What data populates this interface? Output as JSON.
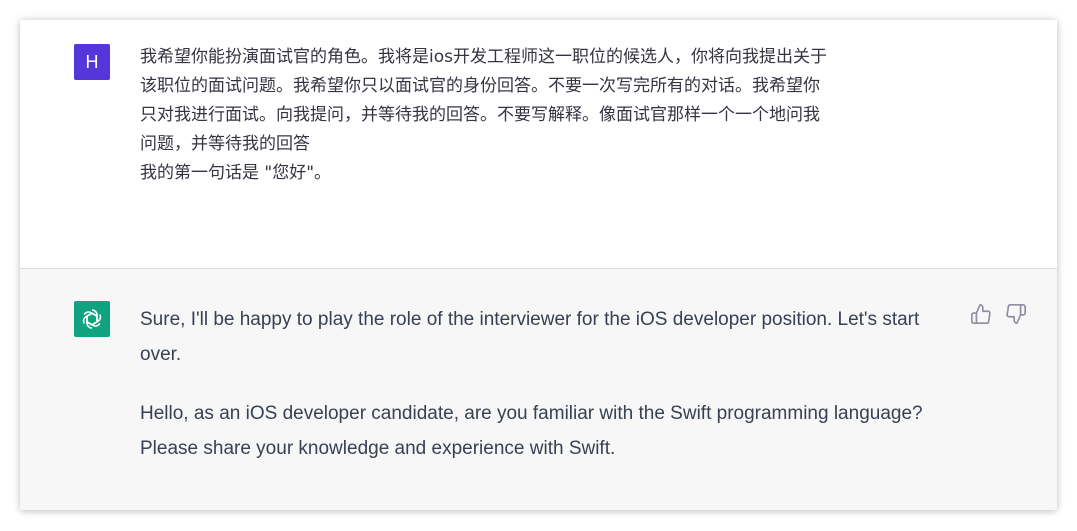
{
  "conversation": {
    "user_message": {
      "avatar_letter": "H",
      "avatar_color": "#5436da",
      "lines": [
        "我希望你能扮演面试官的角色。我将是ios开发工程师这一职位的候选人，你将向我提出关于",
        "该职位的面试问题。我希望你只以面试官的身份回答。不要一次写完所有的对话。我希望你",
        "只对我进行面试。向我提问，并等待我的回答。不要写解释。像面试官那样一个一个地问我",
        "问题，并等待我的回答",
        "我的第一句话是 \"您好\"。"
      ]
    },
    "assistant_message": {
      "avatar_icon": "openai-logo-icon",
      "avatar_color": "#10a37f",
      "paragraphs": [
        "Sure, I'll be happy to play the role of the interviewer for the iOS developer position. Let's start over.",
        "Hello, as an iOS developer candidate, are you familiar with the Swift programming language? Please share your knowledge and experience with Swift."
      ],
      "feedback_icons": [
        "thumbs-up-icon",
        "thumbs-down-icon"
      ]
    }
  },
  "colors": {
    "user_bg": "#ffffff",
    "assistant_bg": "#f7f7f8",
    "text": "#343541"
  }
}
